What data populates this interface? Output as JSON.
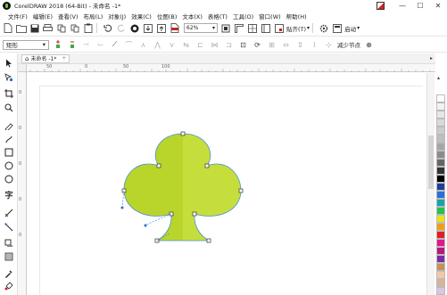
{
  "titlebar": {
    "title": "CorelDRAW 2018 (64-Bit) - 未命名 -1*",
    "minimize": "—",
    "maximize": "☐",
    "close": "✕"
  },
  "menu": [
    "文件(F)",
    "编辑(E)",
    "查看(V)",
    "布局(L)",
    "对象(J)",
    "效果(C)",
    "位图(B)",
    "文本(X)",
    "表格(T)",
    "工具(O)",
    "窗口(W)",
    "帮助(H)"
  ],
  "toolbar": {
    "zoom_value": "62%",
    "snap_label": "贴齐(T)",
    "launch_label": "启动"
  },
  "propertybar": {
    "shape_mode": "矩形",
    "reduce_nodes": "减少节点"
  },
  "tab": {
    "label": "未命名 -1*",
    "add": "+"
  },
  "ruler": {
    "top_ticks": [
      "50",
      "0",
      "50",
      "100"
    ],
    "left_ticks": [
      "0",
      "0",
      "0",
      "0",
      "0"
    ]
  },
  "colors": {
    "leaf_left": "#b9d52b",
    "leaf_right": "#c5de3b",
    "outline_selection": "#4a90d9",
    "accent_green": "#7dc242"
  },
  "palette": [
    "#ffffff",
    "#f2f2f2",
    "#e6e6e6",
    "#d9d9d9",
    "#cccccc",
    "#bfbfbf",
    "#a6a6a6",
    "#8c8c8c",
    "#666666",
    "#333333",
    "#000000",
    "#1f3f9a",
    "#2a6fd8",
    "#17a3a8",
    "#25c24c",
    "#e8e21a",
    "#f29d1a",
    "#e31d24",
    "#e0188b",
    "#b7177e",
    "#7a2ca0",
    "#c98f5a",
    "#f3c9a3",
    "#d7b29a",
    "#d6c7e6",
    "#c2d9ef"
  ]
}
